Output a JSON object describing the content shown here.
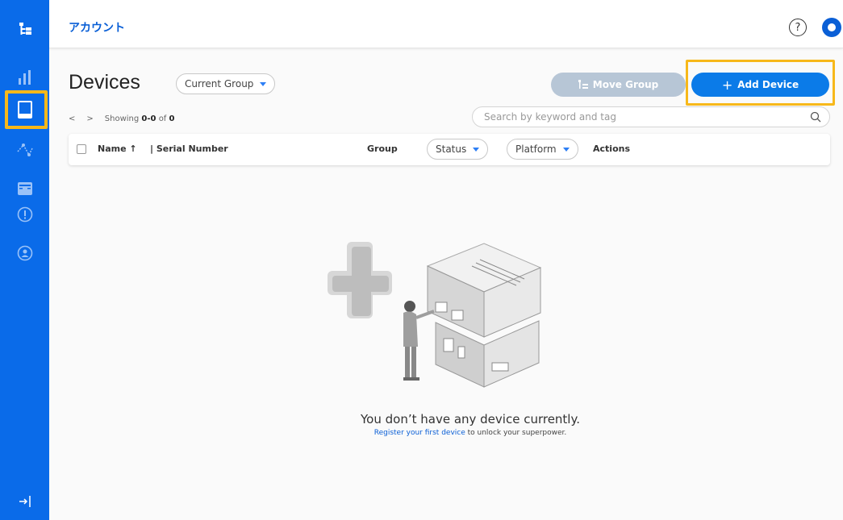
{
  "header": {
    "account_label": "アカウント"
  },
  "sidebar": {
    "items": [
      {
        "name": "tree-icon"
      },
      {
        "name": "bar-chart-icon"
      },
      {
        "name": "device-icon"
      },
      {
        "name": "network-icon"
      },
      {
        "name": "inbox-icon"
      },
      {
        "name": "alert-icon"
      },
      {
        "name": "user-shield-icon"
      },
      {
        "name": "collapse-icon"
      }
    ]
  },
  "page": {
    "title": "Devices",
    "group_filter": "Current Group",
    "move_group_label": "Move Group",
    "add_device_label": "Add Device"
  },
  "pager": {
    "showing_prefix": "Showing",
    "range": "0-0",
    "of_label": "of",
    "total": "0"
  },
  "search": {
    "placeholder": "Search by keyword and tag"
  },
  "table": {
    "col_name": "Name ↑",
    "col_serial": "| Serial Number",
    "col_group": "Group",
    "col_status": "Status",
    "col_platform": "Platform",
    "col_actions": "Actions"
  },
  "empty": {
    "title": "You don’t have any device currently.",
    "link": "Register your first device",
    "rest": " to unlock your superpower."
  },
  "colors": {
    "accent": "#0a6be9",
    "highlight": "#f7b81a",
    "button_disabled": "#b7c6d6"
  }
}
